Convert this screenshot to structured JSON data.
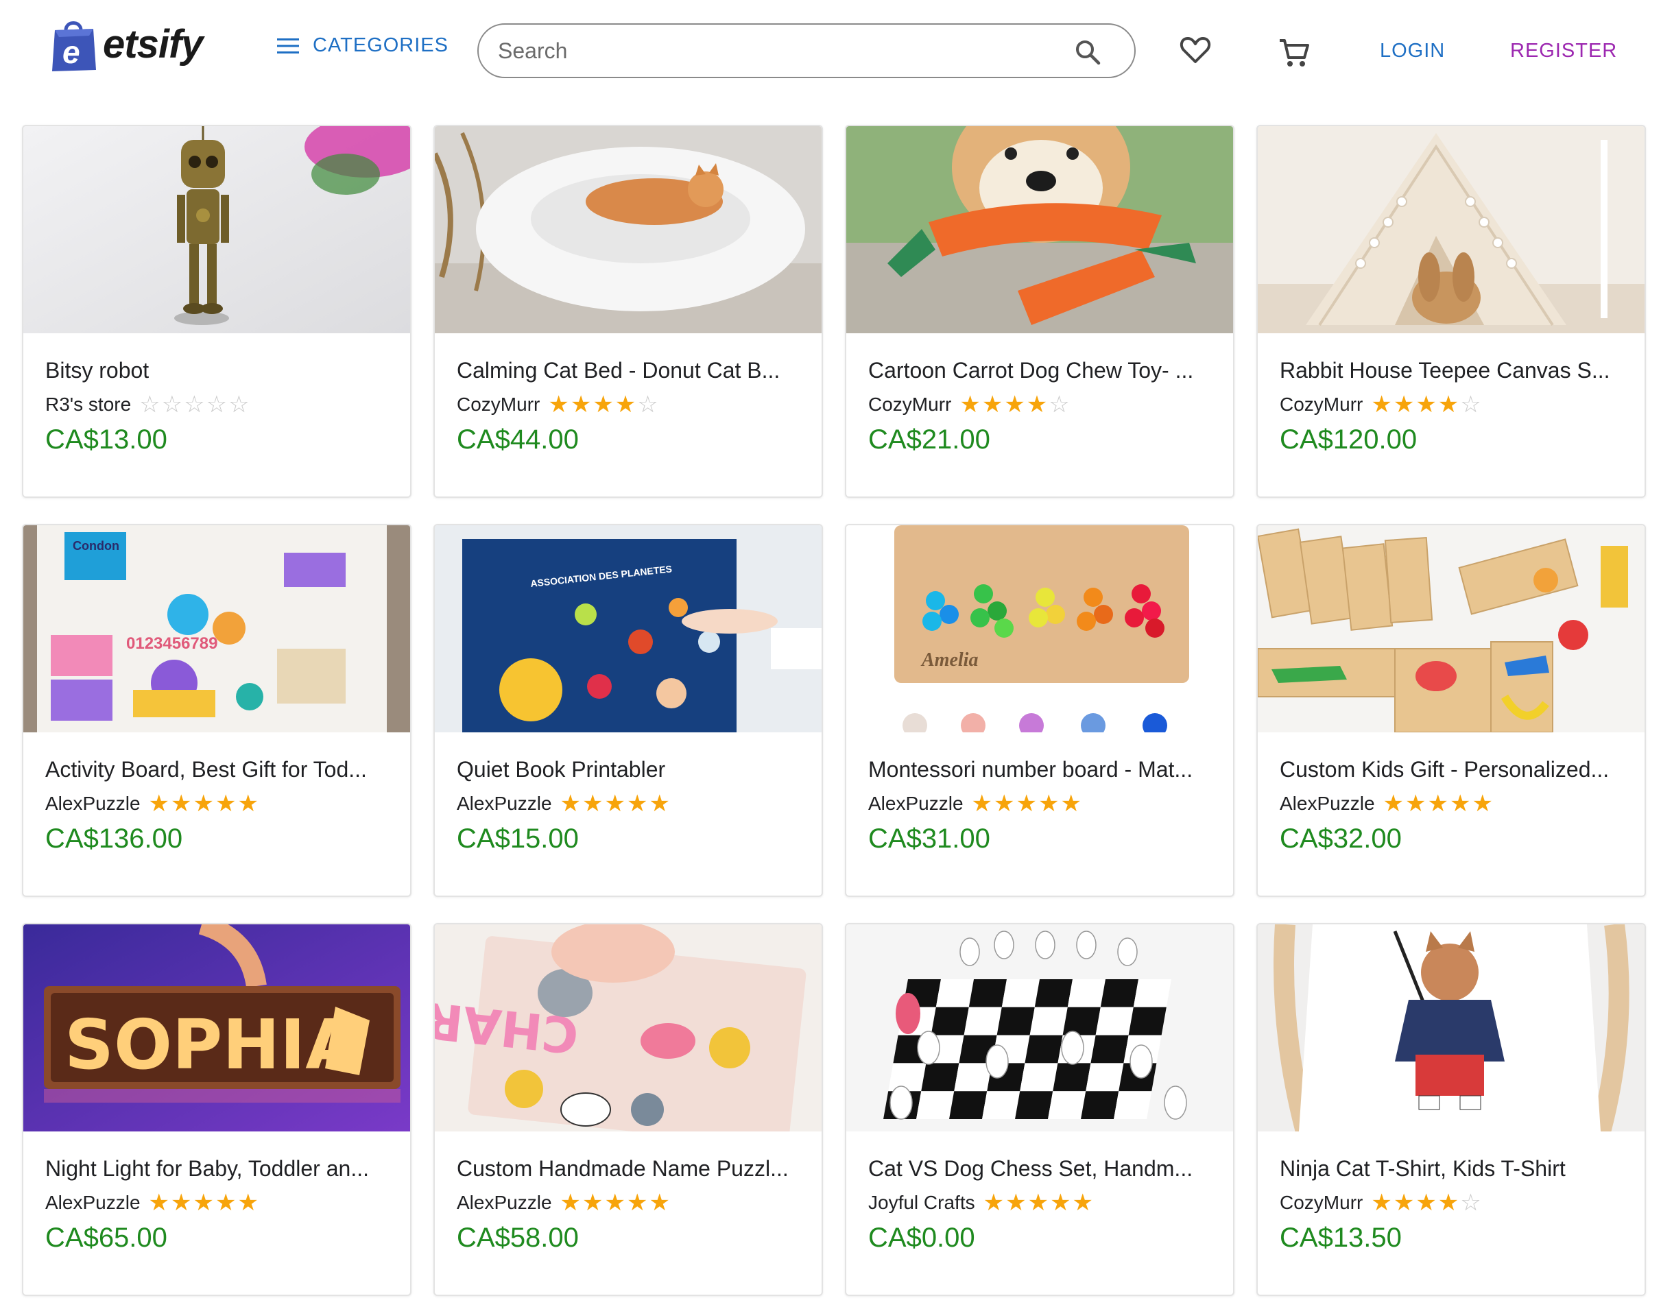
{
  "header": {
    "logo_text": "etsify",
    "categories_label": "CATEGORIES",
    "search_placeholder": "Search",
    "login_label": "LOGIN",
    "register_label": "REGISTER"
  },
  "colors": {
    "accent_blue": "#1e6fc4",
    "register_purple": "#9c27b0",
    "price_green": "#1f8a1f",
    "star_gold": "#f7a40b"
  },
  "products": [
    {
      "title": "Bitsy robot",
      "seller": "R3's store",
      "rating": 0,
      "price": "CA$13.00",
      "image": "robot-figurine"
    },
    {
      "title": "Calming Cat Bed - Donut Cat B...",
      "seller": "CozyMurr",
      "rating": 4,
      "price": "CA$44.00",
      "image": "cat-in-donut-bed"
    },
    {
      "title": "Cartoon Carrot Dog Chew Toy- ...",
      "seller": "CozyMurr",
      "rating": 4,
      "price": "CA$21.00",
      "image": "dog-with-carrot-toy"
    },
    {
      "title": "Rabbit House Teepee Canvas S...",
      "seller": "CozyMurr",
      "rating": 4,
      "price": "CA$120.00",
      "image": "rabbit-in-teepee"
    },
    {
      "title": "Activity Board, Best Gift for Tod...",
      "seller": "AlexPuzzle",
      "rating": 5,
      "price": "CA$136.00",
      "image": "busy-board"
    },
    {
      "title": "Quiet Book Printabler",
      "seller": "AlexPuzzle",
      "rating": 5,
      "price": "CA$15.00",
      "image": "planets-quiet-book"
    },
    {
      "title": "Montessori number board - Mat...",
      "seller": "AlexPuzzle",
      "rating": 5,
      "price": "CA$31.00",
      "image": "pompom-number-board"
    },
    {
      "title": "Custom Kids Gift - Personalized...",
      "seller": "AlexPuzzle",
      "rating": 5,
      "price": "CA$32.00",
      "image": "animal-dominoes"
    },
    {
      "title": "Night Light for Baby, Toddler an...",
      "seller": "AlexPuzzle",
      "rating": 5,
      "price": "CA$65.00",
      "image": "sophia-night-light"
    },
    {
      "title": "Custom Handmade Name Puzzl...",
      "seller": "AlexPuzzle",
      "rating": 5,
      "price": "CA$58.00",
      "image": "charlie-name-puzzle"
    },
    {
      "title": "Cat VS Dog Chess Set, Handm...",
      "seller": "Joyful Crafts",
      "rating": 5,
      "price": "CA$0.00",
      "image": "cat-dog-chess-set"
    },
    {
      "title": "Ninja Cat T-Shirt, Kids T-Shirt",
      "seller": "CozyMurr",
      "rating": 4,
      "price": "CA$13.50",
      "image": "ninja-cat-tshirt"
    }
  ],
  "artwork": {
    "busy_board_label": "Condon",
    "busy_board_digits": "0123456789",
    "quiet_book_heading": "ASSOCIATION DES PLANETES",
    "number_board_name": "Amelia",
    "night_light_name": "SOPHIA",
    "puzzle_name": "CHARLIE"
  }
}
